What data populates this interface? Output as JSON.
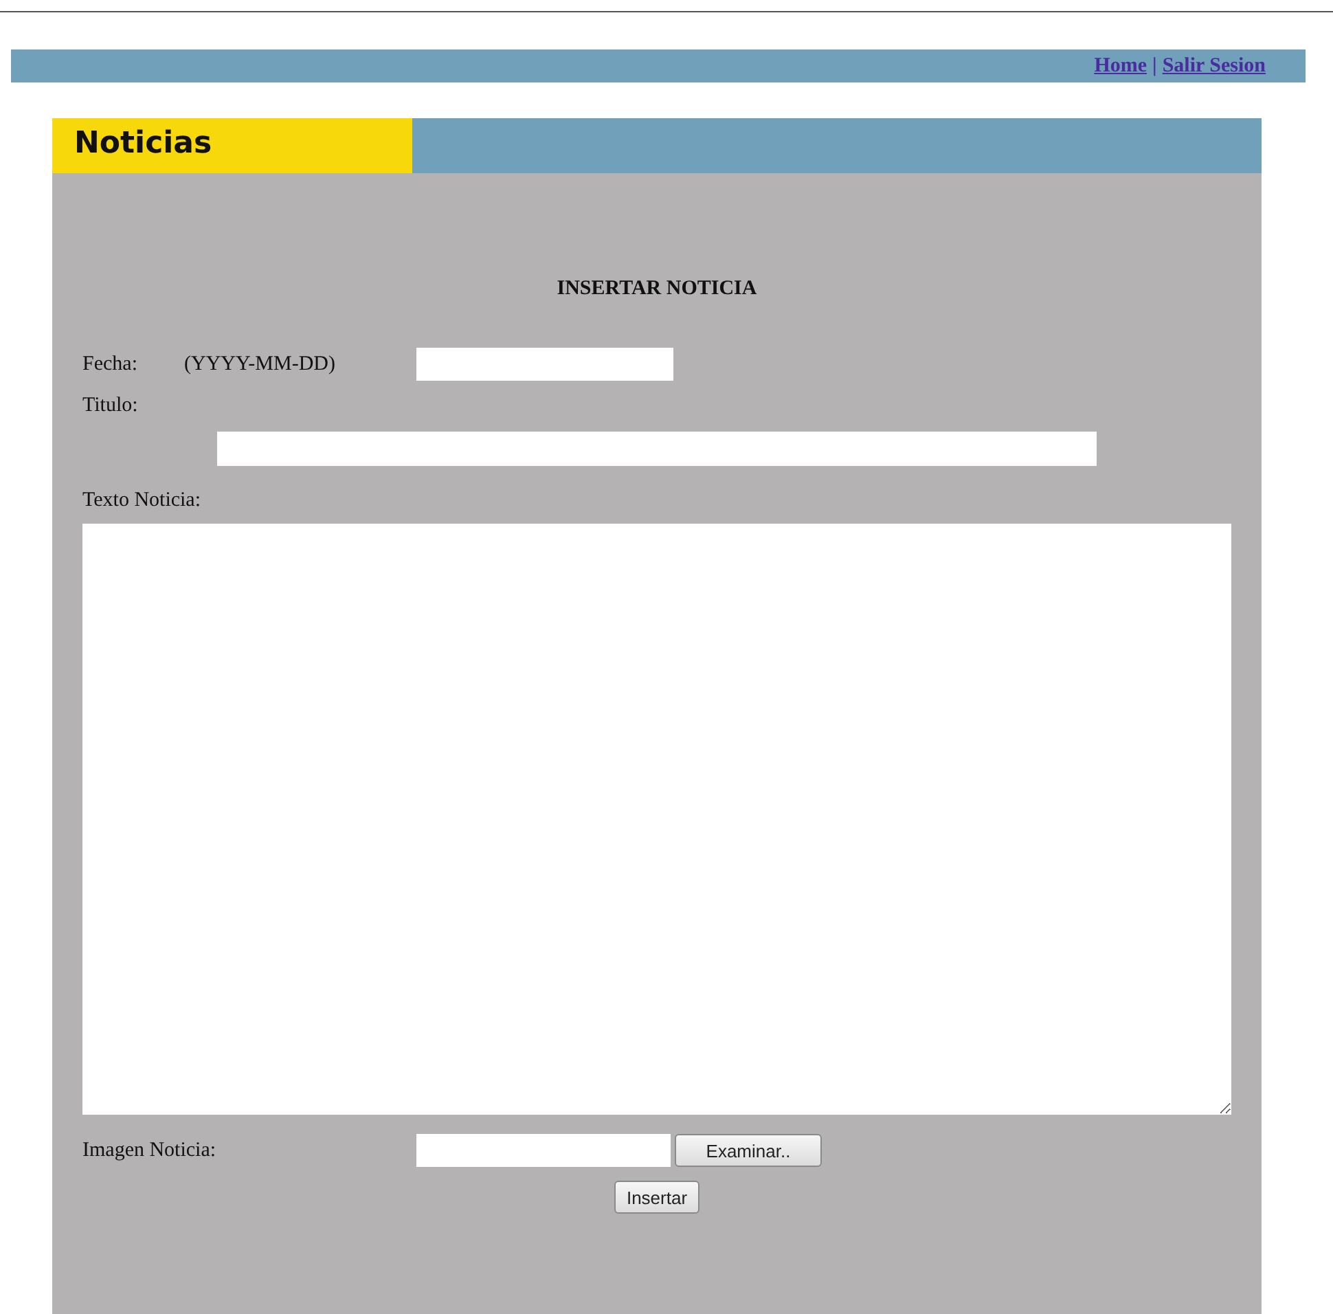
{
  "nav": {
    "links": [
      {
        "label": "Home"
      },
      {
        "label": "Salir Sesion"
      }
    ],
    "separator": "|"
  },
  "panel": {
    "title": "Noticias"
  },
  "form": {
    "heading": "INSERTAR NOTICIA",
    "fecha": {
      "label": "Fecha:",
      "hint": "(YYYY-MM-DD)"
    },
    "titulo": {
      "label": "Titulo:"
    },
    "texto": {
      "label": "Texto Noticia:"
    },
    "imagen": {
      "label": "Imagen Noticia:",
      "browse": "Examinar.."
    },
    "submit": "Insertar"
  }
}
